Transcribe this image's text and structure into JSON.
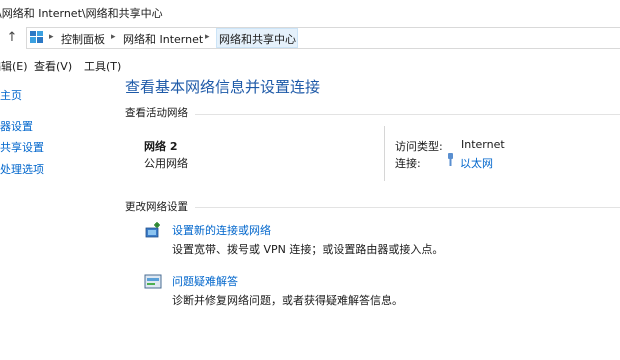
{
  "window": {
    "title": "\\网络和 Internet\\网络和共享中心"
  },
  "address_bar": {
    "breadcrumbs": [
      "控制面板",
      "网络和 Internet",
      "网络和共享中心"
    ]
  },
  "menu": {
    "items": [
      "编辑(E)",
      "查看(V)",
      "工具(T)"
    ],
    "visible_labels": [
      "编辑(E)",
      "查看(V)",
      "工具(T)"
    ]
  },
  "left_pane": {
    "links": [
      "主页",
      "器设置",
      "共享设置",
      "处理选项"
    ]
  },
  "main": {
    "heading": "查看基本网络信息并设置连接",
    "active_networks_label": "查看活动网络",
    "network_name": "网络 2",
    "network_type": "公用网络",
    "access_type_label": "访问类型:",
    "access_type_value": "Internet",
    "connection_label": "连接:",
    "connection_value": "以太网",
    "change_settings_label": "更改网络设置",
    "tasks": [
      {
        "title": "设置新的连接或网络",
        "description": "设置宽带、拨号或 VPN 连接；或设置路由器或接入点。"
      },
      {
        "title": "问题疑难解答",
        "description": "诊断并修复网络问题，或者获得疑难解答信息。"
      }
    ]
  },
  "colors": {
    "heading_blue": "#1e5aa8",
    "link_blue": "#0066cc",
    "selected_crumb": "#e5f1fb"
  }
}
